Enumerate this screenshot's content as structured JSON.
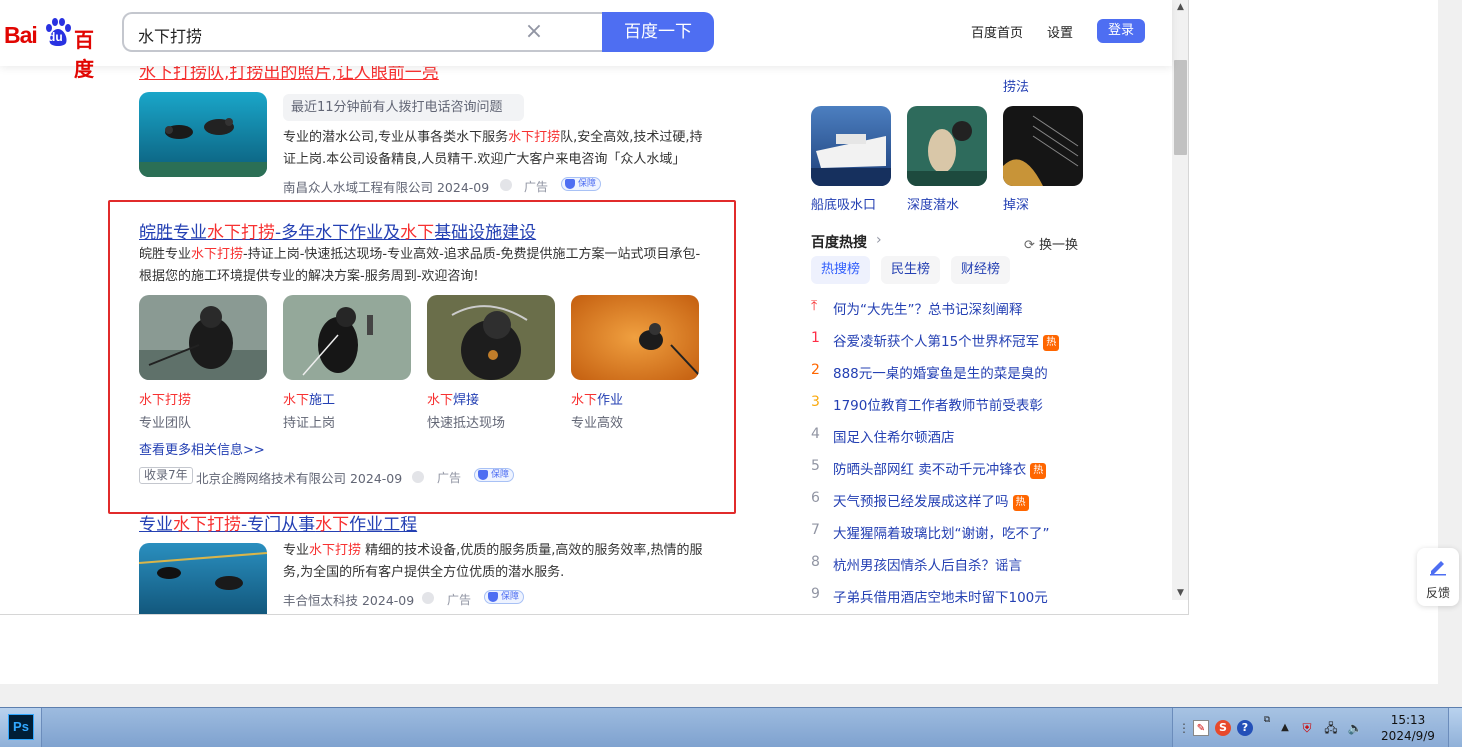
{
  "header": {
    "logo_bai": "Bai",
    "logo_du": "du",
    "logo_cn": "百度",
    "search_value": "水下打捞",
    "search_button": "百度一下",
    "links": [
      "百度首页",
      "设置"
    ],
    "login": "登录"
  },
  "results": {
    "r1": {
      "title_partial": "水下打捞队,打捞出的照片,让人眼前一亮",
      "badge": "最近11分钟前有人拨打电话咨询问题",
      "desc_a": "专业的潜水公司,专业从事各类水下服务",
      "desc_em": "水下打捞",
      "desc_b": "队,安全高效,技术过硬,持证上岗.本公司设备精良,人员精干.欢迎广大客户来电咨询「众人水域」",
      "source": "南昌众人水域工程有限公司 2024-09",
      "ad": "广告",
      "shield": "保障"
    },
    "r2": {
      "title_a": "皖胜专业",
      "title_em1": "水下打捞",
      "title_b": "-多年水下作业及",
      "title_em2": "水下",
      "title_c": "基础设施建设",
      "desc_a": "皖胜专业",
      "desc_em": "水下打捞",
      "desc_b": "-持证上岗-快速抵达现场-专业高效-追求品质-免费提供施工方案一站式项目承包-根据您的施工环境提供专业的解决方案-服务周到-欢迎咨询!",
      "images": [
        {
          "em": "水下打捞",
          "rest": "",
          "sub": "专业团队"
        },
        {
          "em": "水下",
          "rest": "施工",
          "sub": "持证上岗"
        },
        {
          "em": "水下",
          "rest": "焊接",
          "sub": "快速抵达现场"
        },
        {
          "em": "水下",
          "rest": "作业",
          "sub": "专业高效"
        }
      ],
      "more": "查看更多相关信息>>",
      "years": "收录7年",
      "source": "北京企腾网络技术有限公司 2024-09",
      "ad": "广告",
      "shield": "保障"
    },
    "r3": {
      "title_a": "专业",
      "title_em1": "水下打捞",
      "title_b": "-专门从事",
      "title_em2": "水下",
      "title_c": "作业工程",
      "desc_a": "专业",
      "desc_em": "水下打捞",
      "desc_b": " 精细的技术设备,优质的服务质量,高效的服务效率,热情的服务,为全国的所有客户提供全方位优质的潜水服务.",
      "source": "丰合恒太科技 2024-09",
      "ad": "广告",
      "shield": "保障"
    }
  },
  "right": {
    "top_caption": "捞法",
    "images": [
      {
        "caption": "船底吸水口"
      },
      {
        "caption": "深度潜水"
      },
      {
        "caption": "掉深"
      }
    ],
    "hot_title": "百度热搜",
    "refresh": "换一换",
    "tabs": [
      "热搜榜",
      "民生榜",
      "财经榜"
    ],
    "hot_items": [
      {
        "num": "",
        "text": "何为“大先生”？总书记深刻阐释",
        "tag": ""
      },
      {
        "num": "1",
        "text": "谷爱凌斩获个人第15个世界杯冠军",
        "tag": "热"
      },
      {
        "num": "2",
        "text": "888元一桌的婚宴鱼是生的菜是臭的",
        "tag": ""
      },
      {
        "num": "3",
        "text": "1790位教育工作者教师节前受表彰",
        "tag": ""
      },
      {
        "num": "4",
        "text": "国足入住希尔顿酒店",
        "tag": ""
      },
      {
        "num": "5",
        "text": "防晒头部网红 卖不动千元冲锋衣",
        "tag": "热"
      },
      {
        "num": "6",
        "text": "天气预报已经发展成这样了吗",
        "tag": "热"
      },
      {
        "num": "7",
        "text": "大猩猩隔着玻璃比划“谢谢，吃不了”",
        "tag": ""
      },
      {
        "num": "8",
        "text": "杭州男孩因情杀人后自杀？谣言",
        "tag": ""
      },
      {
        "num": "9",
        "text": "子弟兵借用酒店空地未时留下100元",
        "tag": ""
      }
    ],
    "colors": {
      "pin": "#f73131",
      "n1": "#fe2d46",
      "n2": "#f60",
      "n3": "#faa90e",
      "rest": "#9195a3"
    }
  },
  "feedback": "反馈",
  "taskbar": {
    "ps": "Ps",
    "time": "15:13",
    "date": "2024/9/9"
  }
}
